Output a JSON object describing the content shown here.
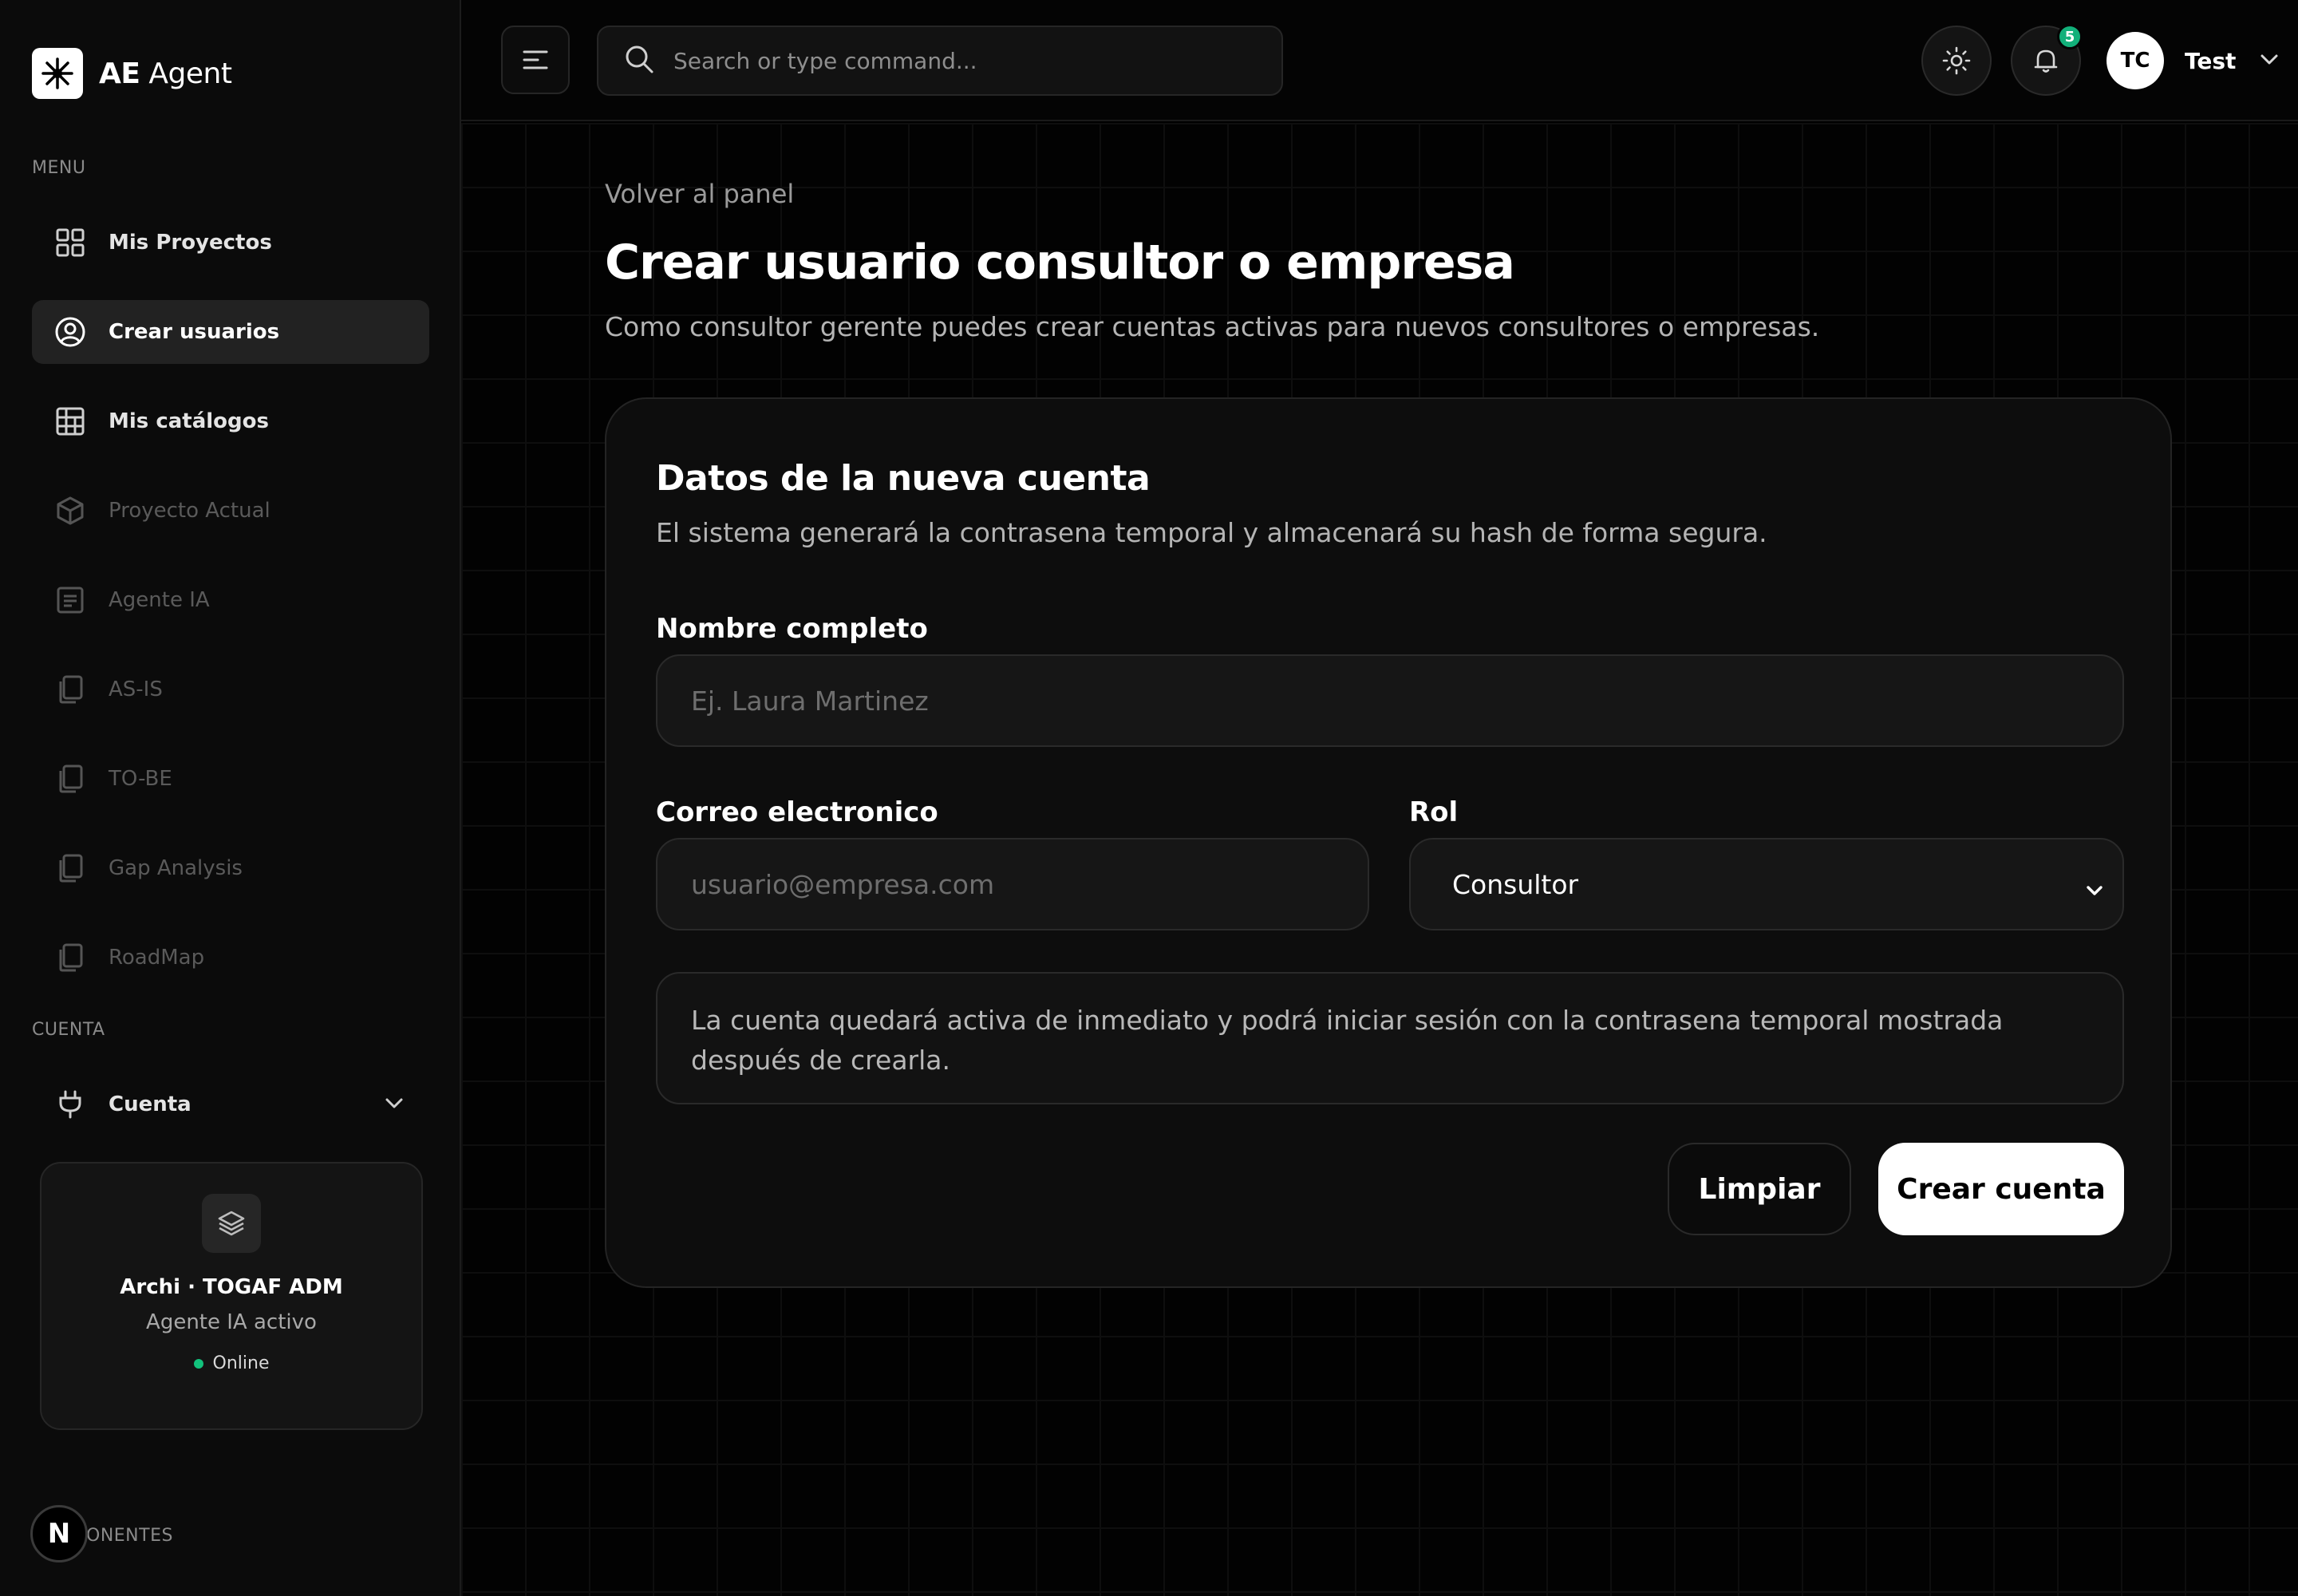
{
  "app": {
    "brand_bold": "AE",
    "brand_rest": "Agent"
  },
  "sidebar": {
    "menu_title": "MENU",
    "items": [
      {
        "label": "Mis Proyectos",
        "icon": "grid-icon",
        "state": "normal"
      },
      {
        "label": "Crear usuarios",
        "icon": "user-circle-icon",
        "state": "active"
      },
      {
        "label": "Mis catálogos",
        "icon": "table-icon",
        "state": "normal"
      },
      {
        "label": "Proyecto Actual",
        "icon": "box-icon",
        "state": "disabled"
      },
      {
        "label": "Agente IA",
        "icon": "document-lines-icon",
        "state": "disabled"
      },
      {
        "label": "AS-IS",
        "icon": "copy-icon",
        "state": "disabled"
      },
      {
        "label": "TO-BE",
        "icon": "copy-icon",
        "state": "disabled"
      },
      {
        "label": "Gap Analysis",
        "icon": "copy-icon",
        "state": "disabled"
      },
      {
        "label": "RoadMap",
        "icon": "copy-icon",
        "state": "disabled"
      }
    ],
    "account_title": "CUENTA",
    "account_item": {
      "label": "Cuenta",
      "icon": "plug-icon"
    },
    "agent_card": {
      "title": "Archi · TOGAF ADM",
      "subtitle": "Agente IA activo",
      "status": "Online",
      "status_color": "#12c27c"
    },
    "components_title": "ONENTES",
    "next_badge": "N"
  },
  "topbar": {
    "search_placeholder": "Search or type command...",
    "notification_count": "5",
    "user_initials": "TC",
    "user_name": "Test"
  },
  "main": {
    "back_link": "Volver al panel",
    "title": "Crear usuario consultor o empresa",
    "subtitle": "Como consultor gerente puedes crear cuentas activas para nuevos consultores o empresas.",
    "card": {
      "title": "Datos de la nueva cuenta",
      "subtitle": "El sistema generará la contrasena temporal y almacenará su hash de forma segura.",
      "name_label": "Nombre completo",
      "name_placeholder": "Ej. Laura Martinez",
      "email_label": "Correo electronico",
      "email_placeholder": "usuario@empresa.com",
      "role_label": "Rol",
      "role_value": "Consultor",
      "notice": "La cuenta quedará activa de inmediato y podrá iniciar sesión con la contrasena temporal mostrada después de crearla.",
      "clear_button": "Limpiar",
      "create_button": "Crear cuenta"
    }
  },
  "colors": {
    "background": "#000000",
    "sidebar": "#0b0b0b",
    "active_item": "#222222",
    "badge_green": "#12b07a",
    "primary_button": "#ffffff"
  }
}
